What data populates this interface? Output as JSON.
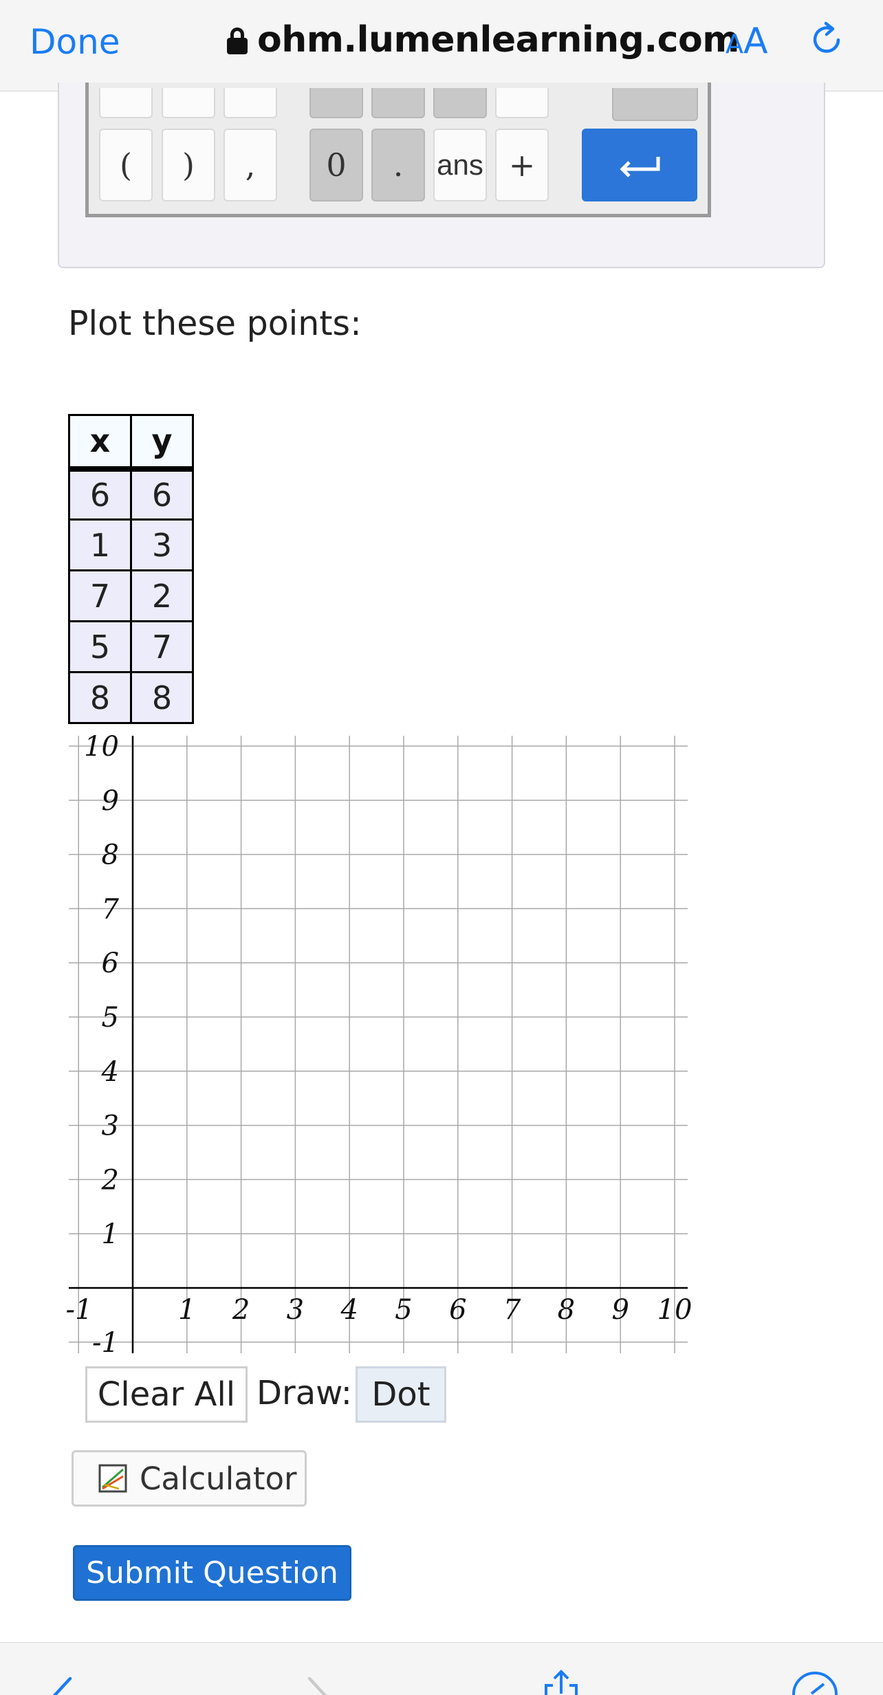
{
  "browser": {
    "done_label": "Done",
    "url": "ohm.lumenlearning.com",
    "text_size_small": "A",
    "text_size_big": "A",
    "accent": "#1a7cf5"
  },
  "calculator": {
    "row_keys": [
      "(",
      ")",
      ",",
      "0",
      ".",
      "ans",
      "+"
    ],
    "enter_icon": "return-arrow-icon",
    "enter_color": "#2b76d8"
  },
  "prompt": "Plot these points:",
  "points_table": {
    "headers": [
      "x",
      "y"
    ],
    "rows": [
      [
        "6",
        "6"
      ],
      [
        "1",
        "3"
      ],
      [
        "7",
        "2"
      ],
      [
        "5",
        "7"
      ],
      [
        "8",
        "8"
      ]
    ]
  },
  "chart_data": {
    "type": "scatter",
    "x": [],
    "y": [],
    "xlim": [
      -1,
      10
    ],
    "ylim": [
      -1,
      10
    ],
    "x_ticks": [
      "-1",
      "1",
      "2",
      "3",
      "4",
      "5",
      "6",
      "7",
      "8",
      "9",
      "10"
    ],
    "y_ticks": [
      "-1",
      "1",
      "2",
      "3",
      "4",
      "5",
      "6",
      "7",
      "8",
      "9",
      "10"
    ],
    "grid": true,
    "title": "",
    "xlabel": "",
    "ylabel": ""
  },
  "controls": {
    "clear_label": "Clear All",
    "draw_label": "Draw:",
    "dot_label": "Dot",
    "calculator_label": "Calculator",
    "submit_label": "Submit Question"
  }
}
